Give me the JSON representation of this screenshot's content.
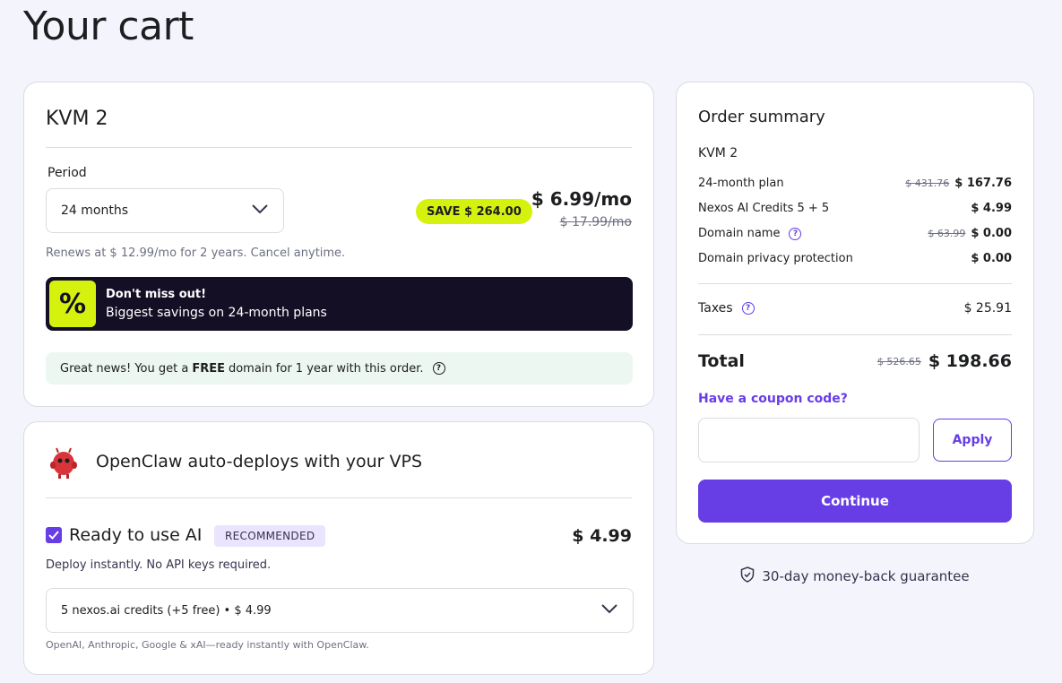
{
  "page": {
    "title": "Your cart"
  },
  "plan": {
    "name": "KVM 2",
    "period_label": "Period",
    "period_value": "24 months",
    "save_badge": "SAVE $ 264.00",
    "price": "$ 6.99/mo",
    "old_price": "$ 17.99/mo",
    "renew_text": "Renews at $ 12.99/mo for 2 years. Cancel anytime.",
    "promo_title": "Don't miss out!",
    "promo_subtitle": "Biggest savings on 24-month plans",
    "promo_icon": "%",
    "free_domain_pre": "Great news! You get a",
    "free_domain_bold": "FREE",
    "free_domain_post": "domain for 1 year with this order."
  },
  "ai": {
    "title": "OpenClaw auto-deploys with your VPS",
    "ready_label": "Ready to use AI",
    "recommended": "RECOMMENDED",
    "price": "$ 4.99",
    "description": "Deploy instantly. No API keys required.",
    "credits_value": "5 nexos.ai credits (+5 free) • $ 4.99",
    "footnote": "OpenAI, Anthropic, Google & xAI—ready instantly with OpenClaw.",
    "checked": true
  },
  "summary": {
    "title": "Order summary",
    "plan": "KVM 2",
    "rows": [
      {
        "label": "24-month plan",
        "old": "$ 431.76",
        "amount": "$ 167.76"
      },
      {
        "label": "Nexos AI Credits 5 + 5",
        "old": "",
        "amount": "$ 4.99"
      },
      {
        "label": "Domain name",
        "old": "$ 63.99",
        "amount": "$ 0.00"
      },
      {
        "label": "Domain privacy protection",
        "old": "",
        "amount": "$ 0.00"
      }
    ],
    "taxes_label": "Taxes",
    "taxes_amount": "$ 25.91",
    "total_label": "Total",
    "total_old": "$ 526.65",
    "total_amount": "$ 198.66",
    "coupon_link": "Have a coupon code?",
    "coupon_placeholder": "",
    "apply_label": "Apply",
    "continue_label": "Continue"
  },
  "guarantee": "30-day money-back guarantee",
  "colors": {
    "accent": "#673de6",
    "lime": "#d5f20f",
    "dark": "#140f25",
    "background": "#f4f4fc"
  }
}
